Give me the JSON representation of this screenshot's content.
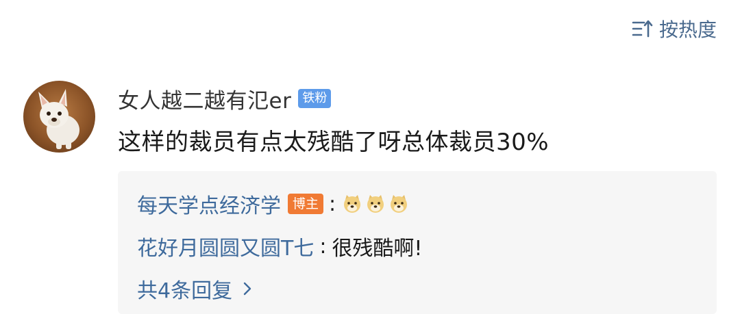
{
  "sort": {
    "label": "按热度",
    "icon": "sort-hot-icon"
  },
  "comment": {
    "avatar_icon": "french-bulldog-avatar",
    "username": "女人越二越有氾er",
    "badge": "铁粉",
    "text": "这样的裁员有点太残酷了呀总体裁员30%"
  },
  "replies": {
    "items": [
      {
        "user": "每天学点经济学",
        "badge": "博主",
        "separator": ":",
        "emoji": [
          "doge",
          "doge",
          "doge"
        ]
      },
      {
        "user": "花好月圆圆又圆T七",
        "separator": ":",
        "text": "很残酷啊!"
      }
    ],
    "more_label": "共4条回复"
  },
  "colors": {
    "link": "#3e6a9c",
    "fan_badge": "#5d9bea",
    "blogger_badge": "#f07a34",
    "reply_bg": "#f6f6f6"
  }
}
